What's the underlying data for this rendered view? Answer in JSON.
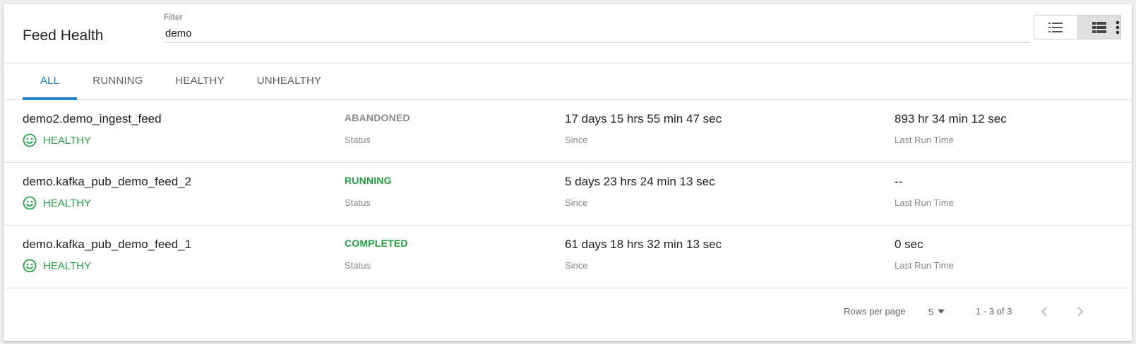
{
  "header": {
    "title": "Feed Health",
    "filter_label": "Filter",
    "filter_value": "demo"
  },
  "view_toggle": {
    "list_icon": "list-view-icon",
    "table_icon": "table-view-icon",
    "active": "table"
  },
  "more_icon": "more-vert-icon",
  "tabs": [
    {
      "label": "ALL",
      "active": true
    },
    {
      "label": "RUNNING",
      "active": false
    },
    {
      "label": "HEALTHY",
      "active": false
    },
    {
      "label": "UNHEALTHY",
      "active": false
    }
  ],
  "rows": [
    {
      "name": "demo2.demo_ingest_feed",
      "health": "HEALTHY",
      "health_icon": "smiley-icon",
      "status": "ABANDONED",
      "status_color": "#8a8a8a",
      "status_label": "Status",
      "since": "17 days 15 hrs 55 min 47 sec",
      "since_label": "Since",
      "last_run": "893 hr 34 min 12 sec",
      "last_run_label": "Last Run Time"
    },
    {
      "name": "demo.kafka_pub_demo_feed_2",
      "health": "HEALTHY",
      "health_icon": "smiley-icon",
      "status": "RUNNING",
      "status_color": "#25a244",
      "status_label": "Status",
      "since": "5 days 23 hrs 24 min 13 sec",
      "since_label": "Since",
      "last_run": "--",
      "last_run_label": "Last Run Time"
    },
    {
      "name": "demo.kafka_pub_demo_feed_1",
      "health": "HEALTHY",
      "health_icon": "smiley-icon",
      "status": "COMPLETED",
      "status_color": "#25a244",
      "status_label": "Status",
      "since": "61 days 18 hrs 32 min 13 sec",
      "since_label": "Since",
      "last_run": "0 sec",
      "last_run_label": "Last Run Time"
    }
  ],
  "pagination": {
    "rows_per_page_label": "Rows per page",
    "rows_per_page": "5",
    "range": "1 - 3 of 3"
  },
  "colors": {
    "accent": "#1e82c8",
    "healthy": "#25a244",
    "muted": "#8a8a8a"
  }
}
